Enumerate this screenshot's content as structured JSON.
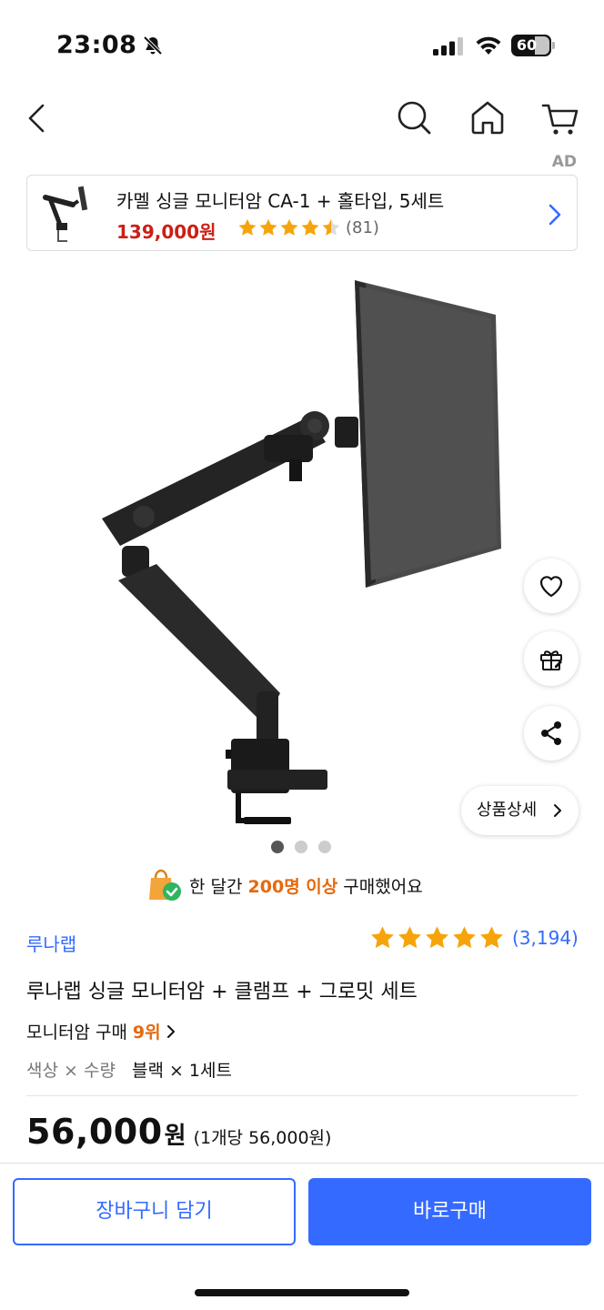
{
  "status_bar": {
    "time": "23:08",
    "battery": "60"
  },
  "header": {
    "icons": [
      "back-chevron-icon",
      "search-icon",
      "home-icon",
      "cart-icon"
    ]
  },
  "ad": {
    "label": "AD",
    "title": "카멜 싱글 모니터암 CA-1 + 홀타입, 5세트",
    "price": "139,000원",
    "rating": 4.5,
    "review_count": "(81)"
  },
  "gallery": {
    "detail_button": "상품상세",
    "slides": 3,
    "active_slide": 1,
    "side_actions": [
      "heart-icon",
      "gift-icon",
      "share-icon"
    ]
  },
  "purchase_stat": {
    "prefix": "한 달간 ",
    "highlight": "200명 이상",
    "suffix": " 구매했어요"
  },
  "product": {
    "brand": "루나랩",
    "rating": 5,
    "review_count": "(3,194)",
    "title": "루나랩 싱글 모니터암 + 클램프 + 그로밋 세트",
    "rank_label": "모니터암 구매",
    "rank_value": "9위",
    "option_label": "색상 × 수량",
    "option_value": "블랙 × 1세트",
    "price": "56,000",
    "price_unit": "원",
    "unit_price": "(1개당 56,000원)"
  },
  "actions": {
    "cart": "장바구니 담기",
    "buy": "바로구매"
  },
  "colors": {
    "accent": "#346aff",
    "price_red": "#cc1f16",
    "highlight_orange": "#e5690d",
    "star": "#f6a40a"
  }
}
